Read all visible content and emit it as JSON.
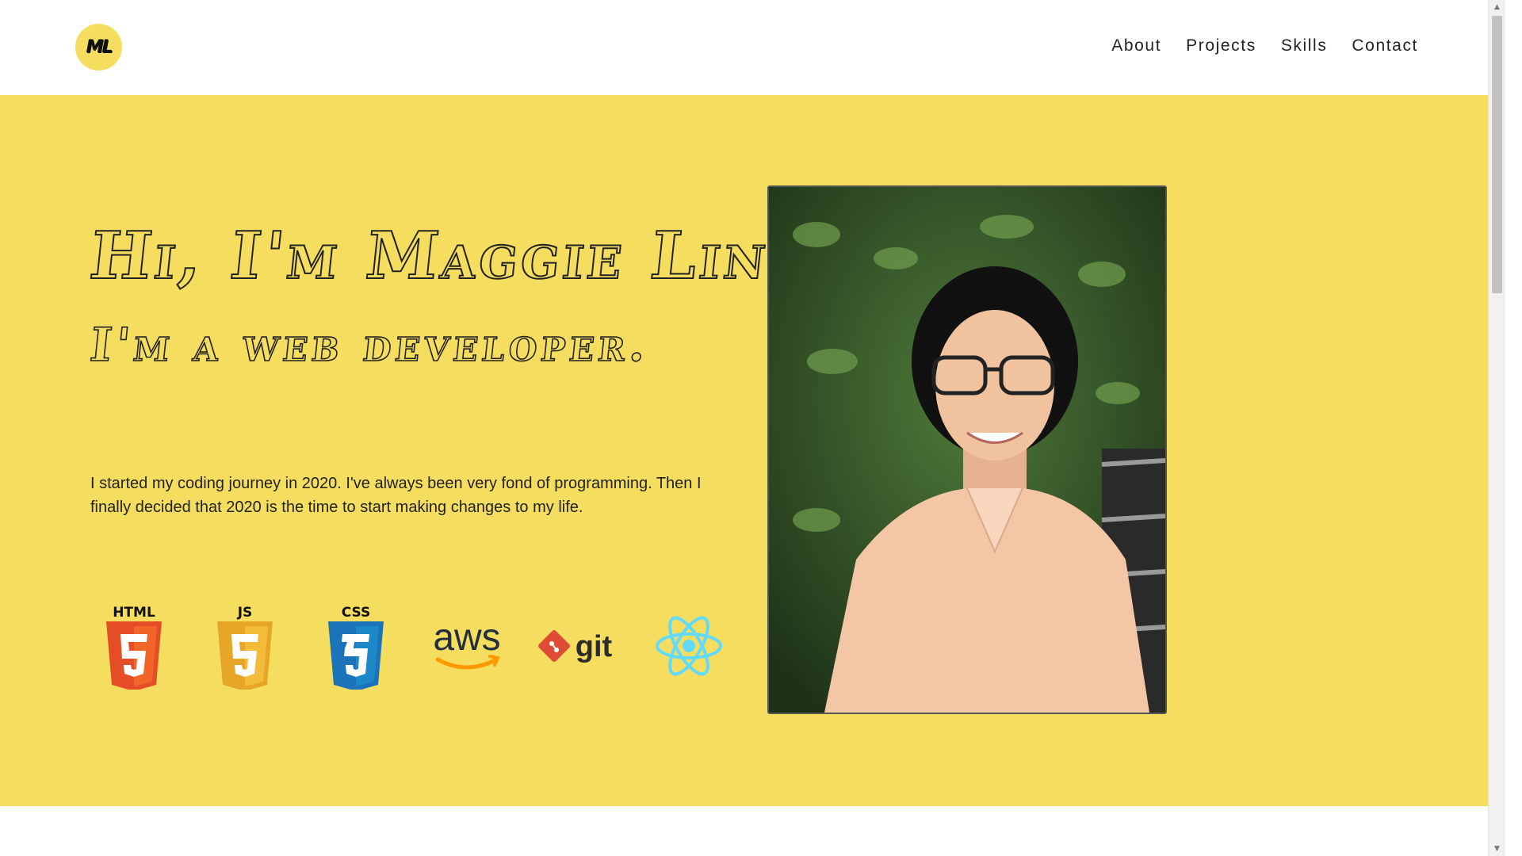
{
  "header": {
    "logo_text": "ML",
    "nav": [
      "About",
      "Projects",
      "Skills",
      "Contact"
    ]
  },
  "hero": {
    "headline": "Hi, I'm Maggie Lin.",
    "subheadline": "I'm a web developer.",
    "bio": "I started my coding journey in 2020. I've always been very fond of programming. Then I finally decided that 2020 is the time to start making changes to my life.",
    "skills": [
      {
        "name": "html5-icon",
        "label": "HTML"
      },
      {
        "name": "javascript-icon",
        "label": "JS"
      },
      {
        "name": "css3-icon",
        "label": "CSS"
      },
      {
        "name": "aws-icon",
        "label": "aws"
      },
      {
        "name": "git-icon",
        "label": "git"
      },
      {
        "name": "react-icon",
        "label": ""
      }
    ]
  },
  "colors": {
    "accent": "#f5de5f",
    "text": "#222222",
    "html": "#e44d26",
    "js": "#e8a628",
    "css": "#1b73ba",
    "aws": "#232f3e",
    "aws_smile": "#f90",
    "git": "#de4c36",
    "react": "#61dafb"
  }
}
